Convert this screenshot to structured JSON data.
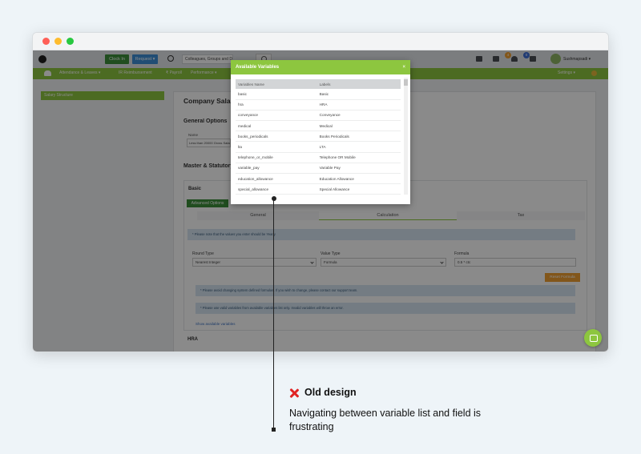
{
  "topbar": {
    "clock_in_label": "Clock In",
    "request_label": "Request ▾",
    "search_placeholder": "Colleagues, Groups and Doc",
    "notification_count": "4",
    "message_count": "0",
    "username": "Sushmapsadi ▾"
  },
  "nav": {
    "items": [
      "Attendance & Leaves ▾",
      "IR Reimbursement",
      "₹ Payroll",
      "Performance ▾"
    ],
    "settings_label": "Settings ▾"
  },
  "sidebar": {
    "active_item": "Salary Structure"
  },
  "page": {
    "title": "Company Salary Structure",
    "general_section": "General Options",
    "name_label": "Name",
    "name_value": "Less than 20000 Gross Salary",
    "master_section": "Master & Statutory Components",
    "basic_label": "Basic",
    "advanced_button": "Advanced Options",
    "tabs": [
      "General",
      "Calculation",
      "Tax"
    ],
    "note_values": "* Please note that the values you enter should be Yearly",
    "round_type_label": "Round Type",
    "round_type_value": "Nearest Integer",
    "value_type_label": "Value Type",
    "value_type_value": "Formula",
    "formula_label": "Formula",
    "formula_value": "0.5 * ctc",
    "reset_button": "Reset Formula",
    "alert_system": "* Please avoid changing system defined formulas. If you wish to change, please contact our support team.",
    "alert_variables": "* Please use valid variables from available variables list only. Invalid variables will throw an error.",
    "show_vars_link": "Show available variables",
    "hra_label": "HRA"
  },
  "modal": {
    "title": "Available Variables",
    "close_label": "×",
    "columns": [
      "Variables Name",
      "Labels"
    ],
    "rows": [
      [
        "basic",
        "Basic"
      ],
      [
        "hra",
        "HRA"
      ],
      [
        "conveyance",
        "Conveyance"
      ],
      [
        "medical",
        "Medical"
      ],
      [
        "books_periodicals",
        "Books Periodicals"
      ],
      [
        "lta",
        "LTA"
      ],
      [
        "telephone_or_mobile",
        "Telephone OR Mobile"
      ],
      [
        "variable_pay",
        "Variable Pay"
      ],
      [
        "education_allowance",
        "Education Allowance"
      ],
      [
        "special_allowance",
        "Special Allowance"
      ]
    ]
  },
  "annotation": {
    "title": "Old design",
    "text": "Navigating between variable list and field is frustrating",
    "accent_color": "#e02424"
  },
  "colors": {
    "brand_green": "#8dc63f",
    "button_green": "#3b8f3a",
    "request_blue": "#3d8fd6",
    "orange": "#f0a030"
  }
}
